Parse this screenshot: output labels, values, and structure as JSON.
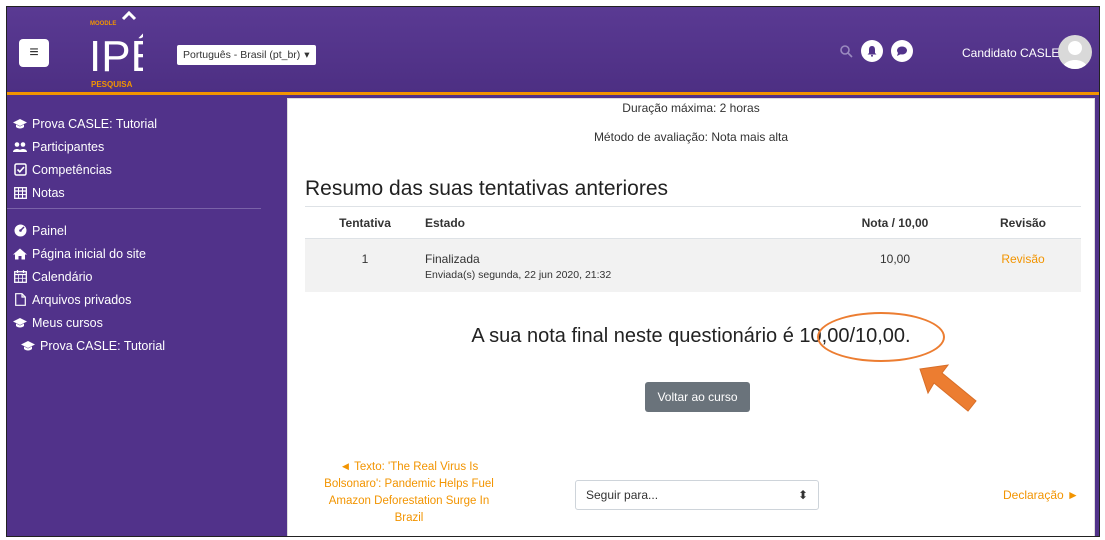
{
  "header": {
    "logo": {
      "top_text": "MOODLE",
      "main_text": "IPÊ",
      "bottom_text": "PESQUISA"
    },
    "language_select": "Português - Brasil (pt_br)",
    "user_name": "Candidato CASLE",
    "icons": [
      "menu-icon",
      "search-icon",
      "bell-icon",
      "chat-icon",
      "avatar"
    ]
  },
  "sidebar": {
    "course_items": [
      {
        "label": "Prova CASLE: Tutorial",
        "icon": "graduation-cap-icon"
      },
      {
        "label": "Participantes",
        "icon": "users-icon"
      },
      {
        "label": "Competências",
        "icon": "checkbox-icon"
      },
      {
        "label": "Notas",
        "icon": "table-icon"
      }
    ],
    "site_items": [
      {
        "label": "Painel",
        "icon": "dashboard-icon"
      },
      {
        "label": "Página inicial do site",
        "icon": "home-icon"
      },
      {
        "label": "Calendário",
        "icon": "calendar-icon"
      },
      {
        "label": "Arquivos privados",
        "icon": "file-icon"
      },
      {
        "label": "Meus cursos",
        "icon": "graduation-cap-icon"
      },
      {
        "label": "Prova CASLE: Tutorial",
        "icon": "graduation-cap-icon"
      }
    ]
  },
  "main": {
    "duration": "Duração máxima: 2 horas",
    "grading_method": "Método de avaliação: Nota mais alta",
    "summary_title": "Resumo das suas tentativas anteriores",
    "table": {
      "headers": [
        "Tentativa",
        "Estado",
        "Nota / 10,00",
        "Revisão"
      ],
      "rows": [
        {
          "attempt": "1",
          "state": "Finalizada",
          "submitted": "Enviada(s) segunda, 22 jun 2020, 21:32",
          "grade": "10,00",
          "review": "Revisão"
        }
      ]
    },
    "final_grade_prefix": "A sua nota final neste questionário é ",
    "final_grade_value": "10,00/10,00.",
    "back_button": "Voltar ao curso",
    "prev_link": "◄ Texto: 'The Real Virus Is Bolsonaro': Pandemic Helps Fuel Amazon Deforestation Surge In Brazil",
    "jump_select": "Seguir para...",
    "next_link": "Declaração ►"
  },
  "colors": {
    "brand_purple": "#51328a",
    "accent_orange": "#f29400",
    "annotation": "#ec7d31"
  }
}
